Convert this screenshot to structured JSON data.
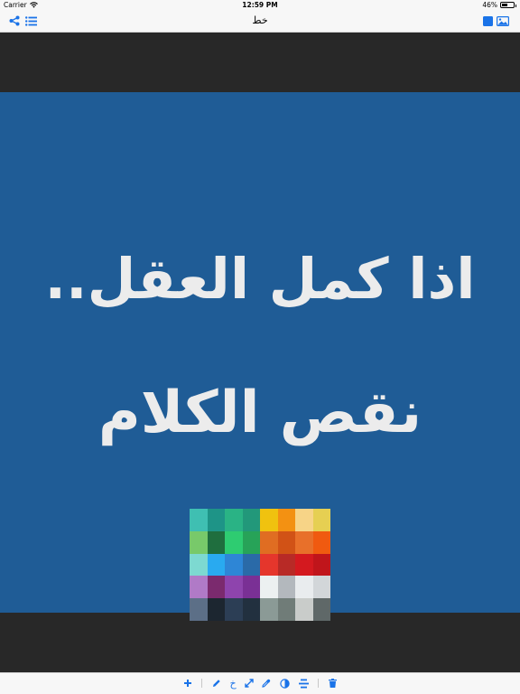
{
  "status": {
    "carrier": "Carrier",
    "time": "12:59 PM",
    "battery": "46%"
  },
  "nav": {
    "title": "خط"
  },
  "canvas": {
    "line1": "اذا كمل العقل..",
    "line2": "نقص الكلام"
  },
  "palette": [
    "#3fbfb2",
    "#1e9487",
    "#2ab385",
    "#22987a",
    "#f0c20f",
    "#f39112",
    "#f7d487",
    "#e6cf52",
    "#78c96a",
    "#1f6e3e",
    "#2ecc71",
    "#27a358",
    "#e06d22",
    "#d15216",
    "#e8702a",
    "#f05a10",
    "#7dd9d1",
    "#29aaf0",
    "#2e86d6",
    "#2a6aa8",
    "#e5362c",
    "#b82a26",
    "#d4191f",
    "#c0151b",
    "#b07ac7",
    "#7b2a6e",
    "#8e44ad",
    "#7a3095",
    "#ecf0f1",
    "#b3b8bd",
    "#e9ecee",
    "#d2d6d9",
    "#5c6f87",
    "#1c2630",
    "#2c3e55",
    "#22303f",
    "#8b9a96",
    "#707c78",
    "#c9ccca",
    "#5f6868"
  ],
  "toolbar": {
    "tools": [
      "add-icon",
      "pencil-icon",
      "font-glyph-icon",
      "resize-icon",
      "eyedropper-icon",
      "contrast-icon",
      "align-icon",
      "trash-icon"
    ],
    "font_glyph": "خ"
  },
  "colors": {
    "accent": "#1a73e8",
    "canvas_bg": "#1f5c96",
    "letterbox": "#282828",
    "text": "#ececec"
  }
}
